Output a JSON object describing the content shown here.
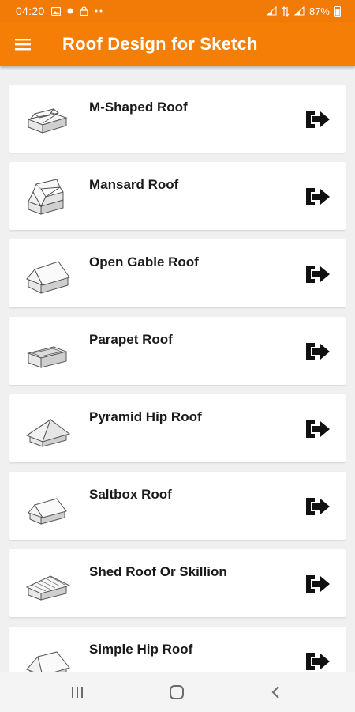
{
  "status_bar": {
    "time": "04:20",
    "battery": "87%",
    "icons": [
      "image-icon",
      "dot-icon",
      "lock-icon",
      "more-icon",
      "signal-icon",
      "data-icon",
      "signal-icon",
      "battery-icon"
    ]
  },
  "app_bar": {
    "title": "Roof Design for Sketch",
    "menu_icon": "hamburger-menu-icon",
    "background": "#f57e06"
  },
  "roofs": [
    {
      "label": "M-Shaped Roof",
      "icon": "m-shaped-roof-icon"
    },
    {
      "label": "Mansard Roof",
      "icon": "mansard-roof-icon"
    },
    {
      "label": "Open Gable Roof",
      "icon": "open-gable-roof-icon"
    },
    {
      "label": "Parapet Roof",
      "icon": "parapet-roof-icon"
    },
    {
      "label": "Pyramid Hip Roof",
      "icon": "pyramid-hip-roof-icon"
    },
    {
      "label": "Saltbox Roof",
      "icon": "saltbox-roof-icon"
    },
    {
      "label": "Shed Roof Or Skillion",
      "icon": "shed-roof-icon"
    },
    {
      "label": "Simple Hip Roof",
      "icon": "simple-hip-roof-icon"
    }
  ],
  "nav_bar": {
    "buttons": [
      "recent-apps-icon",
      "home-icon",
      "back-icon"
    ]
  }
}
